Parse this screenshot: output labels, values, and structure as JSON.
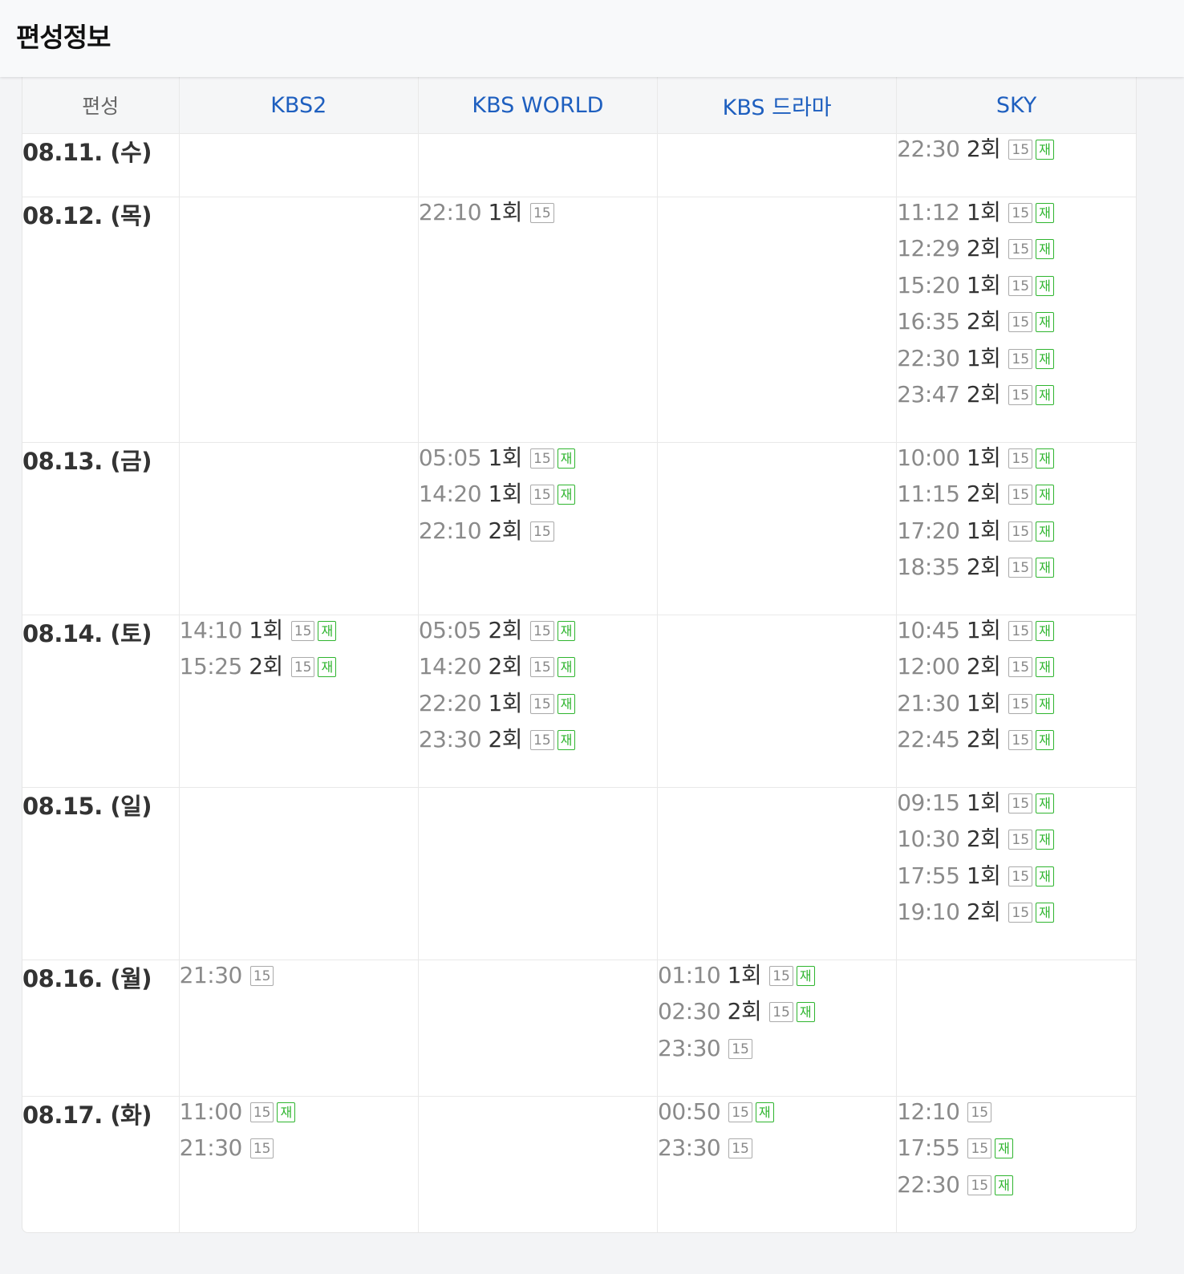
{
  "header": {
    "title": "편성정보"
  },
  "table": {
    "corner_label": "편성",
    "channels": [
      "KBS2",
      "KBS WORLD",
      "KBS 드라마",
      "SKY"
    ],
    "rows": [
      {
        "date": "08.11. (수)",
        "height": 79,
        "cells": [
          [],
          [],
          [],
          [
            {
              "time": "22:30",
              "episode": "2회",
              "rating": "15",
              "rerun": "재"
            }
          ]
        ]
      },
      {
        "date": "08.12. (목)",
        "height": 306,
        "cells": [
          [],
          [
            {
              "time": "22:10",
              "episode": "1회",
              "rating": "15"
            }
          ],
          [],
          [
            {
              "time": "11:12",
              "episode": "1회",
              "rating": "15",
              "rerun": "재"
            },
            {
              "time": "12:29",
              "episode": "2회",
              "rating": "15",
              "rerun": "재"
            },
            {
              "time": "15:20",
              "episode": "1회",
              "rating": "15",
              "rerun": "재"
            },
            {
              "time": "16:35",
              "episode": "2회",
              "rating": "15",
              "rerun": "재"
            },
            {
              "time": "22:30",
              "episode": "1회",
              "rating": "15",
              "rerun": "재"
            },
            {
              "time": "23:47",
              "episode": "2회",
              "rating": "15",
              "rerun": "재"
            }
          ]
        ]
      },
      {
        "date": "08.13. (금)",
        "height": 215,
        "cells": [
          [],
          [
            {
              "time": "05:05",
              "episode": "1회",
              "rating": "15",
              "rerun": "재"
            },
            {
              "time": "14:20",
              "episode": "1회",
              "rating": "15",
              "rerun": "재"
            },
            {
              "time": "22:10",
              "episode": "2회",
              "rating": "15"
            }
          ],
          [],
          [
            {
              "time": "10:00",
              "episode": "1회",
              "rating": "15",
              "rerun": "재"
            },
            {
              "time": "11:15",
              "episode": "2회",
              "rating": "15",
              "rerun": "재"
            },
            {
              "time": "17:20",
              "episode": "1회",
              "rating": "15",
              "rerun": "재"
            },
            {
              "time": "18:35",
              "episode": "2회",
              "rating": "15",
              "rerun": "재"
            }
          ]
        ]
      },
      {
        "date": "08.14. (토)",
        "height": 215,
        "cells": [
          [
            {
              "time": "14:10",
              "episode": "1회",
              "rating": "15",
              "rerun": "재"
            },
            {
              "time": "15:25",
              "episode": "2회",
              "rating": "15",
              "rerun": "재"
            }
          ],
          [
            {
              "time": "05:05",
              "episode": "2회",
              "rating": "15",
              "rerun": "재"
            },
            {
              "time": "14:20",
              "episode": "2회",
              "rating": "15",
              "rerun": "재"
            },
            {
              "time": "22:20",
              "episode": "1회",
              "rating": "15",
              "rerun": "재"
            },
            {
              "time": "23:30",
              "episode": "2회",
              "rating": "15",
              "rerun": "재"
            }
          ],
          [],
          [
            {
              "time": "10:45",
              "episode": "1회",
              "rating": "15",
              "rerun": "재"
            },
            {
              "time": "12:00",
              "episode": "2회",
              "rating": "15",
              "rerun": "재"
            },
            {
              "time": "21:30",
              "episode": "1회",
              "rating": "15",
              "rerun": "재"
            },
            {
              "time": "22:45",
              "episode": "2회",
              "rating": "15",
              "rerun": "재"
            }
          ]
        ]
      },
      {
        "date": "08.15. (일)",
        "height": 215,
        "cells": [
          [],
          [],
          [],
          [
            {
              "time": "09:15",
              "episode": "1회",
              "rating": "15",
              "rerun": "재"
            },
            {
              "time": "10:30",
              "episode": "2회",
              "rating": "15",
              "rerun": "재"
            },
            {
              "time": "17:55",
              "episode": "1회",
              "rating": "15",
              "rerun": "재"
            },
            {
              "time": "19:10",
              "episode": "2회",
              "rating": "15",
              "rerun": "재"
            }
          ]
        ]
      },
      {
        "date": "08.16. (월)",
        "height": 170,
        "cells": [
          [
            {
              "time": "21:30",
              "rating": "15"
            }
          ],
          [],
          [
            {
              "time": "01:10",
              "episode": "1회",
              "rating": "15",
              "rerun": "재"
            },
            {
              "time": "02:30",
              "episode": "2회",
              "rating": "15",
              "rerun": "재"
            },
            {
              "time": "23:30",
              "rating": "15"
            }
          ],
          []
        ]
      },
      {
        "date": "08.17. (화)",
        "height": 170,
        "cells": [
          [
            {
              "time": "11:00",
              "rating": "15",
              "rerun": "재"
            },
            {
              "time": "21:30",
              "rating": "15"
            }
          ],
          [],
          [
            {
              "time": "00:50",
              "rating": "15",
              "rerun": "재"
            },
            {
              "time": "23:30",
              "rating": "15"
            }
          ],
          [
            {
              "time": "12:10",
              "rating": "15"
            },
            {
              "time": "17:55",
              "rating": "15",
              "rerun": "재"
            },
            {
              "time": "22:30",
              "rating": "15",
              "rerun": "재"
            }
          ]
        ]
      }
    ]
  }
}
